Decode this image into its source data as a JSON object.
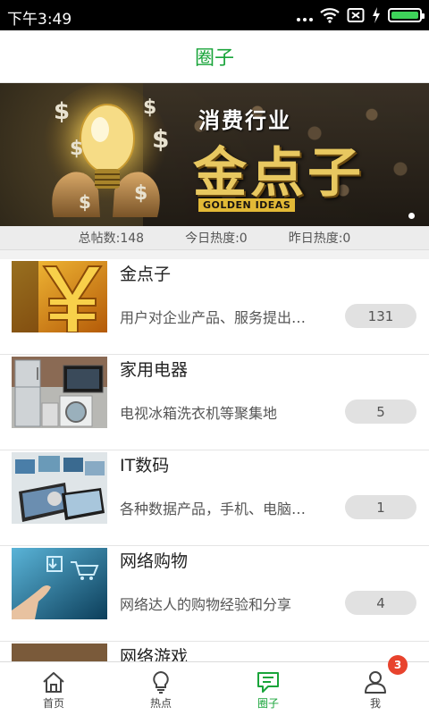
{
  "status_bar": {
    "time": "下午3:49",
    "icons": [
      "more-dots-icon",
      "wifi-icon",
      "no-sim-icon",
      "charging-icon",
      "battery-icon"
    ],
    "battery_color": "#3ed35a"
  },
  "header": {
    "title": "圈子",
    "title_color": "#19a43a"
  },
  "banner": {
    "headline_small": "消费行业",
    "headline_large": "金点子",
    "tagline": "GOLDEN IDEAS",
    "icon": "lightbulb-dollar-icon"
  },
  "stats": {
    "total_posts": "总帖数:148",
    "today_heat": "今日热度:0",
    "yesterday_heat": "昨日热度:0"
  },
  "groups": [
    {
      "name": "金点子",
      "desc": "用户对企业产品、服务提出…",
      "count": "131",
      "image": "yuan-sign-image"
    },
    {
      "name": "家用电器",
      "desc": "电视冰箱洗衣机等聚集地",
      "count": "5",
      "image": "appliances-image"
    },
    {
      "name": "IT数码",
      "desc": "各种数据产品，手机、电脑…",
      "count": "1",
      "image": "tablets-image"
    },
    {
      "name": "网络购物",
      "desc": "网络达人的购物经验和分享",
      "count": "4",
      "image": "touch-screen-cart-image"
    },
    {
      "name": "网络游戏",
      "image": "game-image"
    }
  ],
  "tabbar": {
    "tabs": [
      {
        "label": "首页",
        "icon": "home-icon",
        "active": false
      },
      {
        "label": "热点",
        "icon": "lightbulb-icon",
        "active": false
      },
      {
        "label": "圈子",
        "icon": "chat-icon",
        "active": true
      },
      {
        "label": "我",
        "icon": "user-icon",
        "active": false,
        "badge": "3"
      }
    ],
    "active_color": "#19a43a",
    "badge_color": "#e8432d"
  }
}
